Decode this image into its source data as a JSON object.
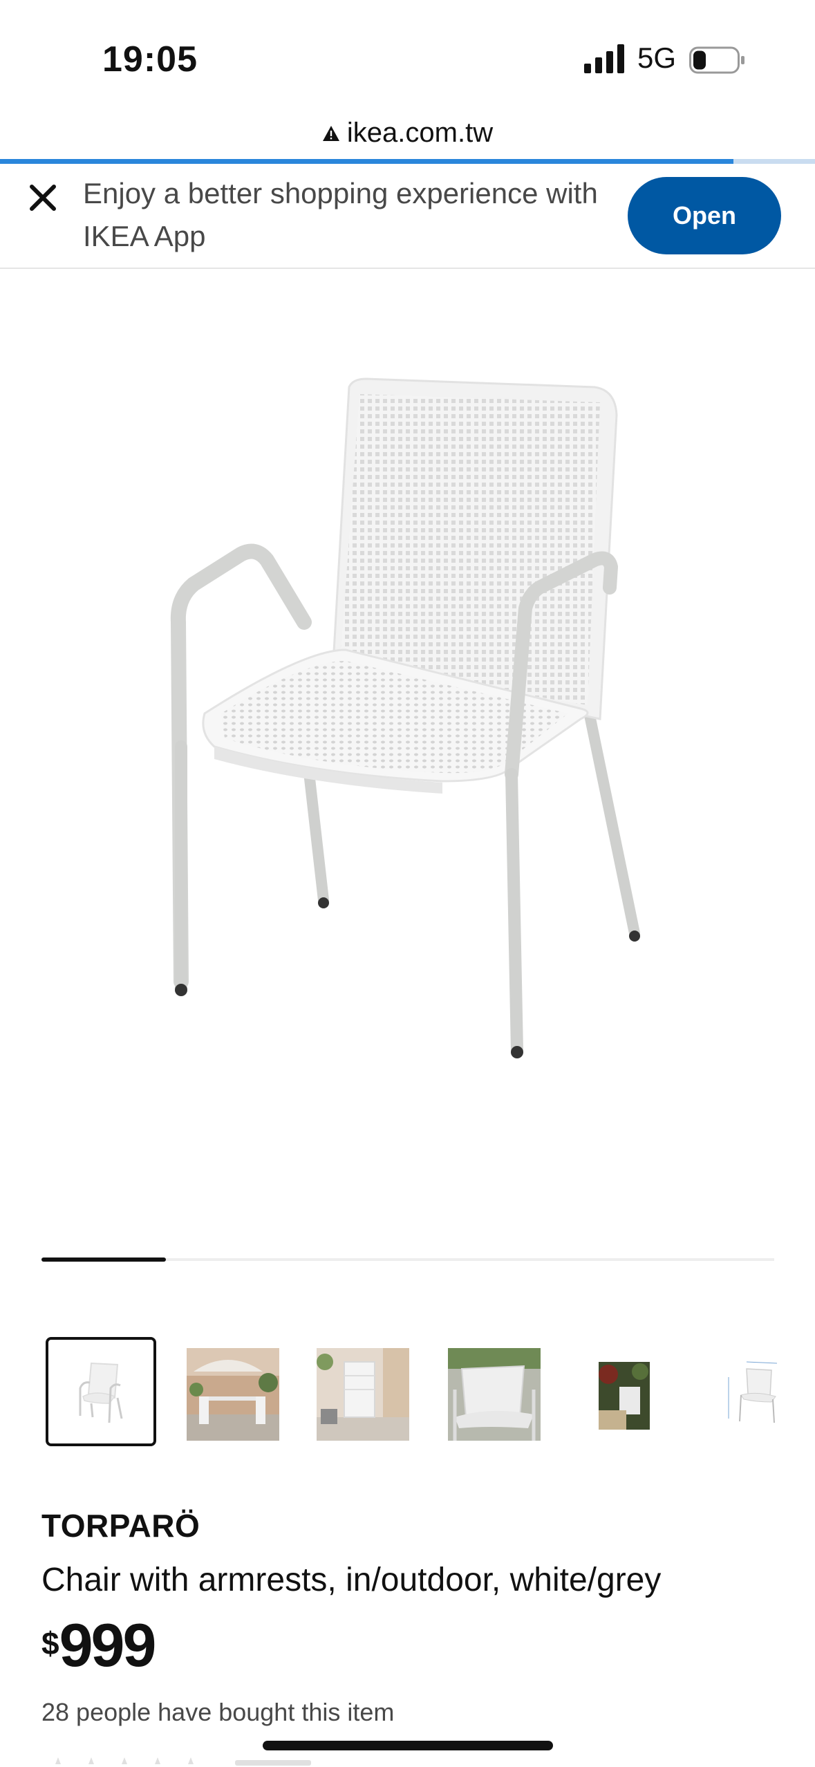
{
  "status_bar": {
    "time": "19:05",
    "network": "5G"
  },
  "browser": {
    "url": "ikea.com.tw",
    "load_progress": 0.9
  },
  "app_banner": {
    "message": "Enjoy a better shopping experience with IKEA App",
    "open_label": "Open"
  },
  "gallery": {
    "slider_position": 0.17,
    "thumbnails": [
      {
        "name": "chair-front"
      },
      {
        "name": "patio-scene"
      },
      {
        "name": "stacked-chairs"
      },
      {
        "name": "chair-closeup"
      },
      {
        "name": "garden-scene"
      },
      {
        "name": "dimension-drawing"
      }
    ]
  },
  "product": {
    "name": "TORPARÖ",
    "description": "Chair with armrests, in/outdoor, white/grey",
    "currency": "$",
    "price": "999",
    "bought_text": "28 people have bought this item"
  },
  "colors": {
    "brand_blue": "#0058a3",
    "progress_blue": "#2a86db",
    "text_grey": "#484848"
  }
}
